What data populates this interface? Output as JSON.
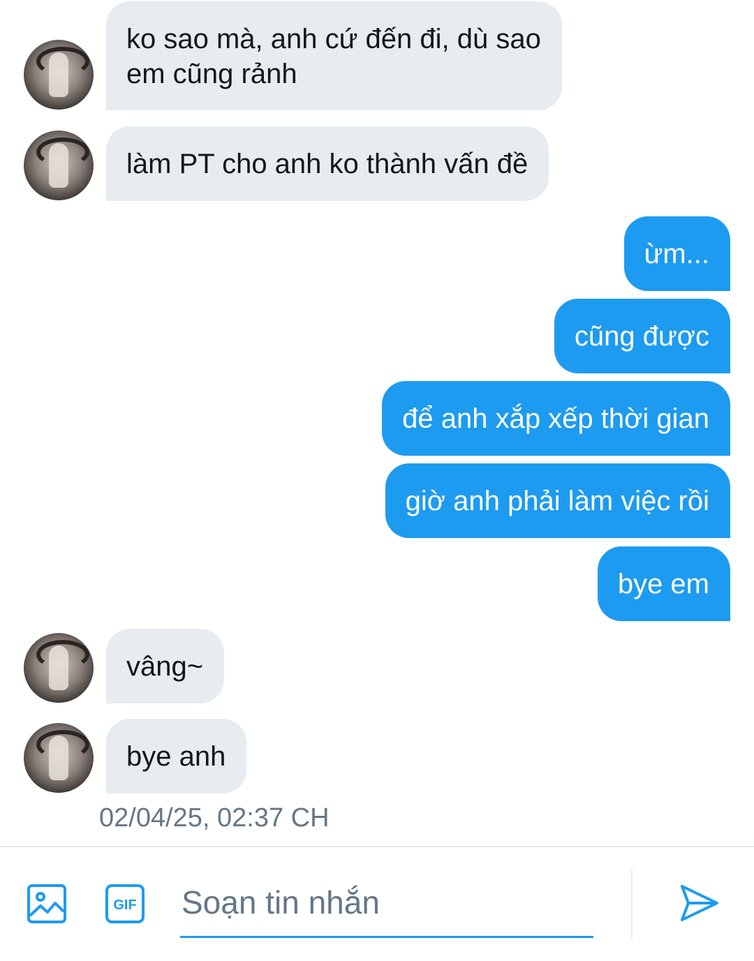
{
  "messages": [
    {
      "direction": "in",
      "lines": [
        "ko sao mà, anh cứ đến đi, dù sao",
        "em cũng rảnh"
      ]
    },
    {
      "direction": "in",
      "lines": [
        "làm PT cho anh ko thành vấn đề"
      ]
    },
    {
      "direction": "out",
      "lines": [
        "ừm..."
      ]
    },
    {
      "direction": "out",
      "lines": [
        "cũng được"
      ]
    },
    {
      "direction": "out",
      "lines": [
        "để anh xắp xếp thời gian"
      ]
    },
    {
      "direction": "out",
      "lines": [
        "giờ anh phải làm việc rồi"
      ]
    },
    {
      "direction": "out",
      "lines": [
        "bye em"
      ]
    },
    {
      "direction": "in",
      "lines": [
        "vâng~"
      ]
    },
    {
      "direction": "in",
      "lines": [
        "bye anh"
      ]
    }
  ],
  "timestamp": "02/04/25, 02:37 CH",
  "composer": {
    "placeholder": "Soạn tin nhắn",
    "value": "",
    "media_icon": "image-icon",
    "gif_icon": "gif-icon",
    "gif_label": "GIF",
    "send_icon": "send-icon"
  },
  "colors": {
    "accent": "#1d9bf0",
    "incoming_bubble": "#e6ecf0",
    "incoming_text": "#14171a",
    "secondary_text": "#657786"
  }
}
